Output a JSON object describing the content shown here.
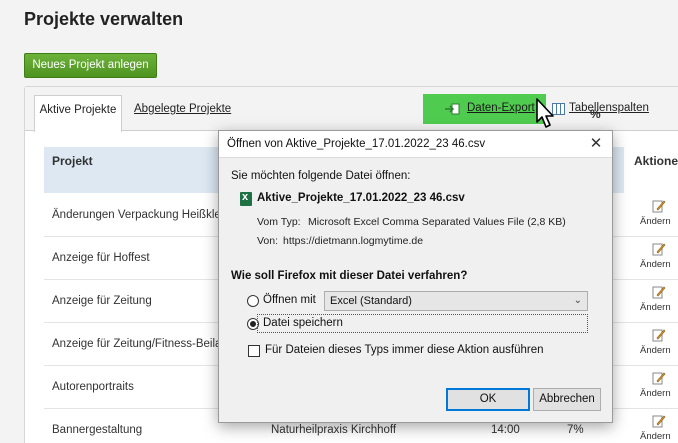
{
  "page": {
    "title": "Projekte verwalten",
    "new_project_button": "Neues Projekt anlegen"
  },
  "tabs": [
    {
      "label": "Aktive Projekte",
      "active": true
    },
    {
      "label": "Abgelegte Projekte",
      "active": false
    }
  ],
  "toolbar": {
    "export_label": "Daten-Export",
    "export_icon": "export-icon",
    "columns_label": "Tabellenspalten",
    "columns_icon": "table-columns-icon",
    "highlight_color": "#4fcc4f"
  },
  "table": {
    "headers": {
      "project": "Projekt",
      "percent": "%",
      "actions": "Aktione"
    },
    "action_label": "Ändern",
    "rows": [
      {
        "name": "Änderungen Verpackung Heißkle",
        "client": "",
        "time": "",
        "pct": ""
      },
      {
        "name": "Anzeige für Hoffest",
        "client": "",
        "time": "",
        "pct": ""
      },
      {
        "name": "Anzeige für Zeitung",
        "client": "",
        "time": "",
        "pct": ""
      },
      {
        "name": "Anzeige für Zeitung/Fitness-Beila",
        "client": "",
        "time": "",
        "pct": ""
      },
      {
        "name": "Autorenportraits",
        "client": "",
        "time": "",
        "pct": ""
      },
      {
        "name": "Bannergestaltung",
        "client": "Naturheilpraxis Kirchhoff",
        "time": "14:00",
        "pct": "7%"
      }
    ]
  },
  "dialog": {
    "title": "Öffnen von Aktive_Projekte_17.01.2022_23 46.csv",
    "question_open": "Sie möchten folgende Datei öffnen:",
    "file_name": "Aktive_Projekte_17.01.2022_23 46.csv",
    "type_label": "Vom Typ:",
    "type_value": "Microsoft Excel Comma Separated Values File (2,8 KB)",
    "from_label": "Von:",
    "from_value": "https://dietmann.logmytime.de",
    "question_action": "Wie soll Firefox mit dieser Datei verfahren?",
    "open_with_label": "Öffnen mit",
    "open_with_app": "Excel (Standard)",
    "save_file_label": "Datei speichern",
    "selected_option": "save",
    "always_label": "Für Dateien dieses Typs immer diese Aktion ausführen",
    "always_checked": false,
    "ok_button": "OK",
    "cancel_button": "Abbrechen"
  }
}
